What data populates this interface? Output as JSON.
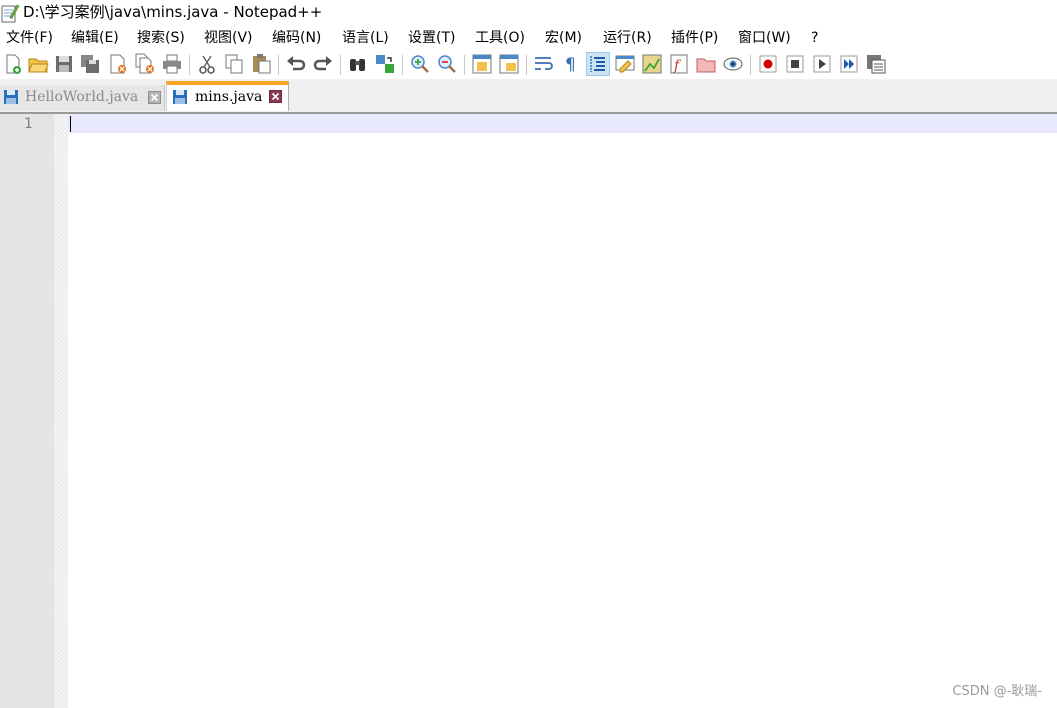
{
  "window": {
    "title": "D:\\学习案例\\java\\mins.java - Notepad++",
    "icon": "notepad-icon"
  },
  "menu": [
    {
      "label": "文件(F)"
    },
    {
      "label": "编辑(E)"
    },
    {
      "label": "搜索(S)"
    },
    {
      "label": "视图(V)"
    },
    {
      "label": "编码(N)"
    },
    {
      "label": "语言(L)"
    },
    {
      "label": "设置(T)"
    },
    {
      "label": "工具(O)"
    },
    {
      "label": "宏(M)"
    },
    {
      "label": "运行(R)"
    },
    {
      "label": "插件(P)"
    },
    {
      "label": "窗口(W)"
    },
    {
      "label": "?"
    }
  ],
  "toolbar": {
    "buttons": [
      "new-file-icon",
      "open-file-icon",
      "save-icon",
      "save-all-icon",
      "close-icon",
      "close-all-icon",
      "print-icon",
      "cut-icon",
      "copy-icon",
      "paste-icon",
      "undo-icon",
      "redo-icon",
      "find-icon",
      "replace-icon",
      "zoom-in-icon",
      "zoom-out-icon",
      "sync-vertical-icon",
      "sync-horizontal-icon",
      "word-wrap-icon",
      "show-all-characters-icon",
      "indent-guide-icon",
      "user-language-icon",
      "document-map-icon",
      "function-list-icon",
      "folder-workspace-icon",
      "monitoring-icon",
      "record-macro-icon",
      "stop-macro-icon",
      "play-macro-icon",
      "run-macro-multiple-icon",
      "save-macro-icon"
    ],
    "active_button": "indent-guide-icon"
  },
  "tabs": [
    {
      "label": "HelloWorld.java",
      "active": false
    },
    {
      "label": "mins.java",
      "active": true
    }
  ],
  "editor": {
    "line_numbers": [
      "1"
    ],
    "content": ""
  },
  "colors": {
    "active_tab_accent": "#f5a623",
    "current_line": "#e8e8ff",
    "gutter": "#e4e4e4"
  },
  "watermark": "CSDN @-耿瑞-"
}
